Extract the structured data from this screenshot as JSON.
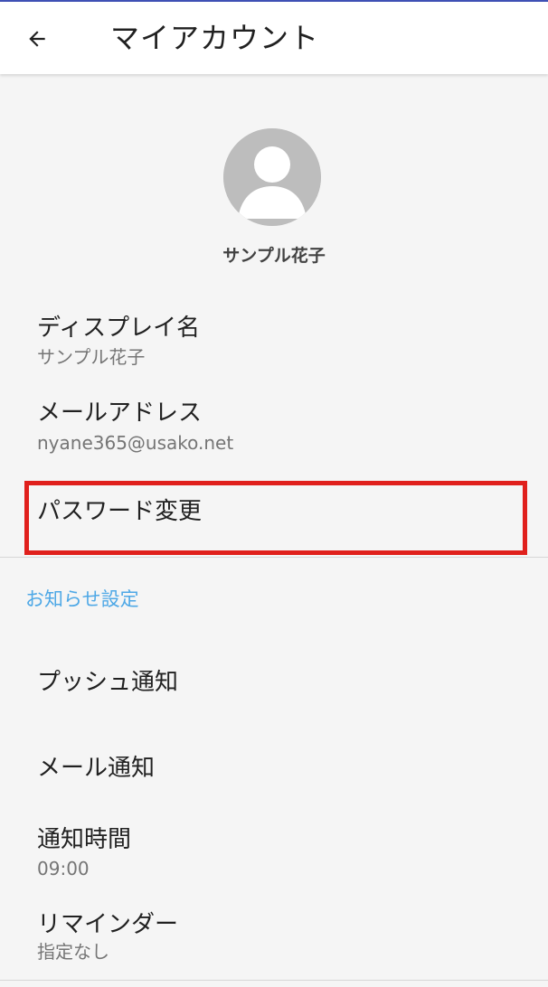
{
  "app_bar": {
    "title": "マイアカウント",
    "back_icon": "arrow-left-icon"
  },
  "profile": {
    "avatar_icon": "default-user-avatar",
    "name": "サンプル花子"
  },
  "account": {
    "display_name": {
      "label": "ディスプレイ名",
      "value": "サンプル花子"
    },
    "email": {
      "label": "メールアドレス",
      "value": "nyane365@usako.net"
    },
    "password": {
      "label": "パスワード変更"
    }
  },
  "notifications": {
    "header": "お知らせ設定",
    "push": {
      "label": "プッシュ通知"
    },
    "mail": {
      "label": "メール通知"
    },
    "time": {
      "label": "通知時間",
      "value": "09:00"
    },
    "reminder": {
      "label": "リマインダー",
      "value": "指定なし"
    }
  },
  "colors": {
    "accent_blue": "#4ea8e6",
    "highlight_red": "#e0201c",
    "background": "#f5f5f5"
  }
}
